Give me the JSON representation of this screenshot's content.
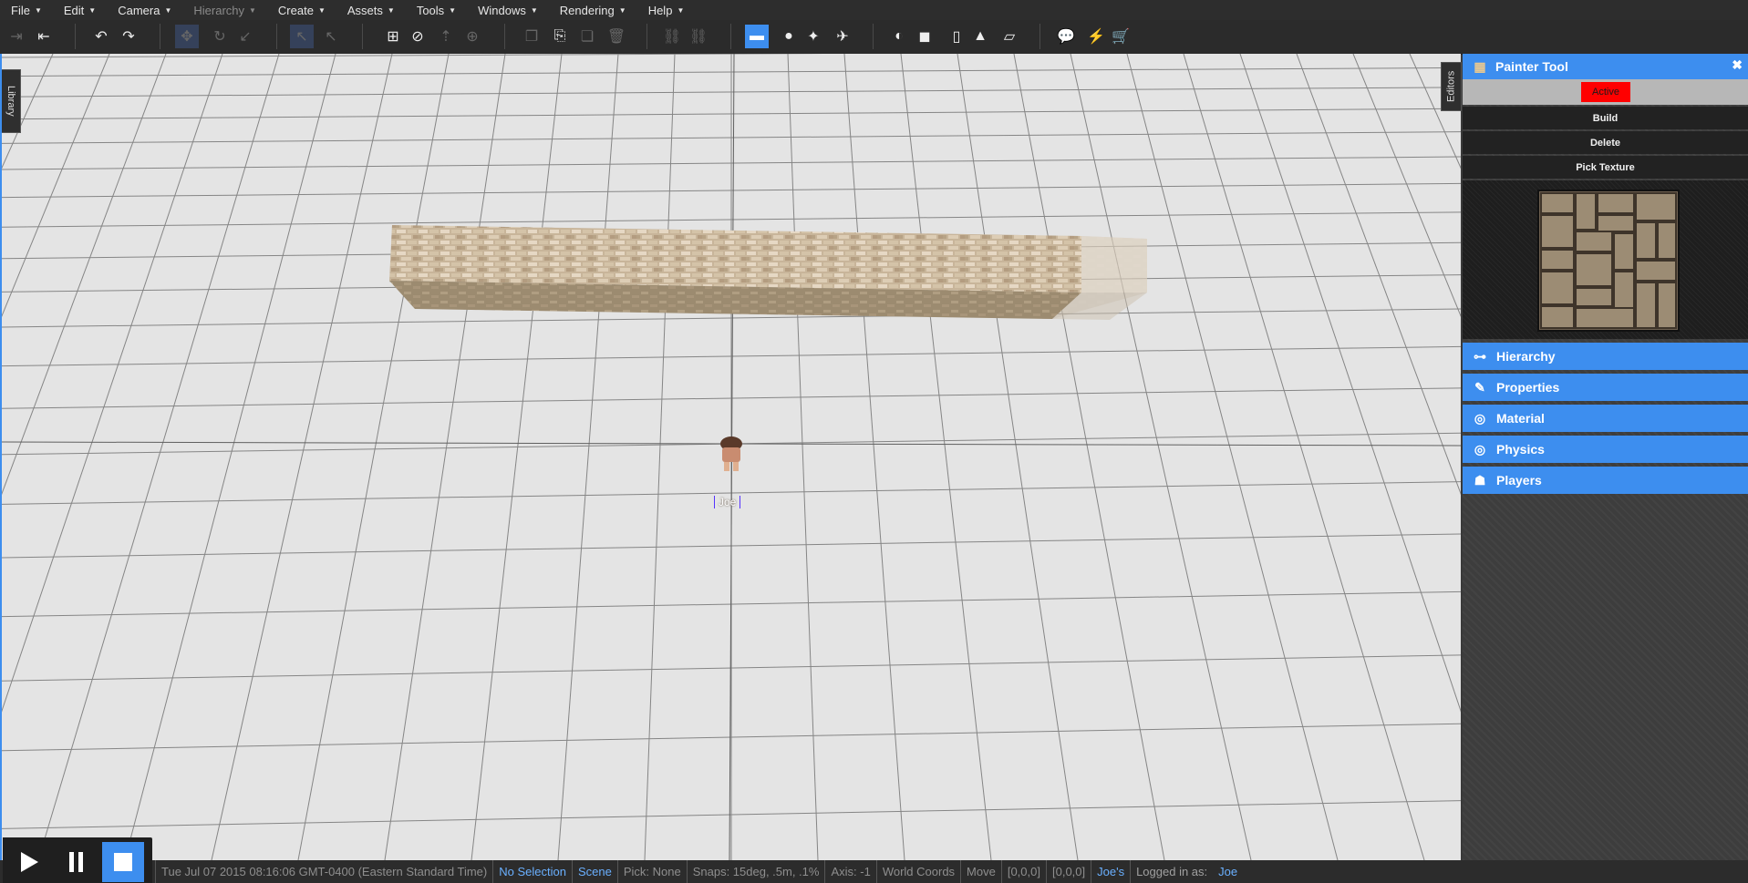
{
  "menu": [
    {
      "label": "File",
      "enabled": true
    },
    {
      "label": "Edit",
      "enabled": true
    },
    {
      "label": "Camera",
      "enabled": true
    },
    {
      "label": "Hierarchy",
      "enabled": false
    },
    {
      "label": "Create",
      "enabled": true
    },
    {
      "label": "Assets",
      "enabled": true
    },
    {
      "label": "Tools",
      "enabled": true
    },
    {
      "label": "Windows",
      "enabled": true
    },
    {
      "label": "Rendering",
      "enabled": true
    },
    {
      "label": "Help",
      "enabled": true
    }
  ],
  "toolbar": {
    "icons": [
      "import-icon",
      "export-icon",
      "undo-icon",
      "redo-icon",
      "move-icon",
      "rotate-icon",
      "scale-icon",
      "select-local-icon",
      "select-parent-icon",
      "grid-select-icon",
      "no-entry-icon",
      "parent-icon",
      "target-icon",
      "copy-icon",
      "paste-icon",
      "clone-icon",
      "delete-icon",
      "link-icon",
      "unlink-icon",
      "camera-icon",
      "avatar-icon",
      "light-icon",
      "plane-icon",
      "sphere-icon",
      "cube-icon",
      "cylinder-icon",
      "cone-icon",
      "grid-plane-icon",
      "chat-icon",
      "lightning-icon",
      "cart-icon"
    ],
    "active_tool": "camera-icon"
  },
  "viewport": {
    "library_tab": "Library",
    "editors_tab": "Editors",
    "avatar_name": "Joe"
  },
  "painter": {
    "title": "Painter Tool",
    "close": "✖",
    "active_label": "Active",
    "buttons": [
      "Build",
      "Delete",
      "Pick Texture"
    ]
  },
  "accordion": [
    {
      "label": "Hierarchy",
      "icon": "hierarchy-icon"
    },
    {
      "label": "Properties",
      "icon": "properties-icon"
    },
    {
      "label": "Material",
      "icon": "material-icon"
    },
    {
      "label": "Physics",
      "icon": "physics-icon"
    },
    {
      "label": "Players",
      "icon": "players-icon"
    }
  ],
  "status": {
    "datetime": "Tue Jul 07 2015 08:16:06 GMT-0400 (Eastern Standard Time)",
    "selection": "No Selection",
    "scene": "Scene",
    "pick": "Pick: None",
    "snaps": "Snaps: 15deg, .5m, .1%",
    "axis": "Axis: -1",
    "coords": "World Coords",
    "mode": "Move",
    "pos": "[0,0,0]",
    "pos2": "[0,0,0]",
    "world": "Joe's",
    "logged_label": "Logged in as:",
    "user": "Joe"
  },
  "colors": {
    "accent": "#3d8eef",
    "active_red": "#ff0000",
    "viewport_bg": "#e4e4e4"
  }
}
